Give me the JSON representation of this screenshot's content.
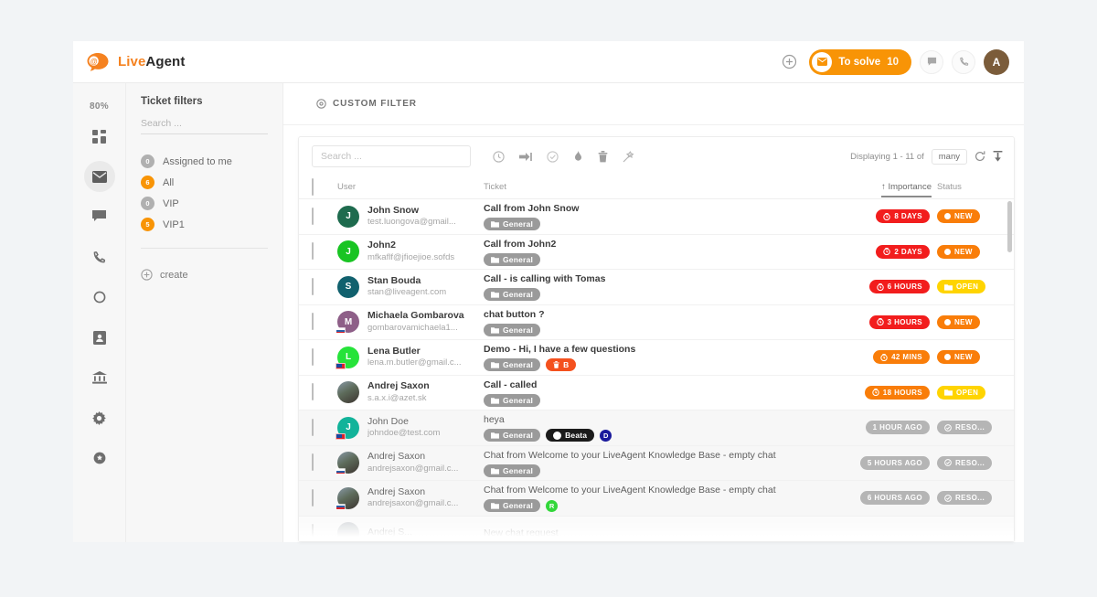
{
  "topbar": {
    "logo_live": "Live",
    "logo_agent": "Agent",
    "add_icon": "plus-circle-icon",
    "tosolve_label": "To solve",
    "tosolve_count": "10",
    "chat_icon": "chat-icon",
    "phone_icon": "phone-icon",
    "avatar_initial": "A"
  },
  "rail": {
    "percent": "80%",
    "items": [
      {
        "icon": "dashboard-grid-icon",
        "active": false
      },
      {
        "icon": "envelope-icon",
        "active": true
      },
      {
        "icon": "chat-bubble-icon",
        "active": false
      },
      {
        "icon": "phone-icon",
        "active": false
      },
      {
        "icon": "circle-outline-icon",
        "active": false
      },
      {
        "icon": "contacts-card-icon",
        "active": false
      },
      {
        "icon": "bank-building-icon",
        "active": false
      },
      {
        "icon": "gear-icon",
        "active": false
      },
      {
        "icon": "settings-filled-icon",
        "active": false
      }
    ]
  },
  "filters": {
    "title": "Ticket filters",
    "search_placeholder": "Search ...",
    "items": [
      {
        "count": "0",
        "label": "Assigned to me",
        "color": "gray"
      },
      {
        "count": "6",
        "label": "All",
        "color": "orange"
      },
      {
        "count": "0",
        "label": "VIP",
        "color": "gray"
      },
      {
        "count": "5",
        "label": "VIP1",
        "color": "orange"
      }
    ],
    "create_label": "create"
  },
  "main": {
    "custom_filter_label": "CUSTOM FILTER",
    "search_placeholder": "Search ...",
    "actions": [
      {
        "icon": "clock-history-icon"
      },
      {
        "icon": "transfer-arrow-icon"
      },
      {
        "icon": "resolve-check-icon"
      },
      {
        "icon": "flame-icon"
      },
      {
        "icon": "trash-icon"
      },
      {
        "icon": "magic-wand-icon"
      }
    ],
    "displaying_text": "Displaying 1 - 11 of",
    "many_label": "many",
    "refresh_icon": "refresh-icon",
    "export_icon": "export-icon",
    "columns": {
      "user": "User",
      "ticket": "Ticket",
      "importance": "↑ Importance",
      "status": "Status"
    }
  },
  "tickets": [
    {
      "name": "John Snow",
      "email": "test.luongova@gmail...",
      "subject": "Call from John Snow",
      "read": false,
      "avatar": {
        "initial": "J",
        "color": "#1e6b4e",
        "photo": false,
        "flag": ""
      },
      "tags": [
        {
          "type": "dept",
          "label": "General"
        }
      ],
      "importance": "8 DAYS",
      "importance_color": "red",
      "importance_icon": "clock-icon",
      "status": "NEW",
      "status_color": "orange",
      "status_icon": "dot-icon"
    },
    {
      "name": "John2",
      "email": "mfkaflf@jfioejioe.sofds",
      "subject": "Call from John2",
      "read": false,
      "avatar": {
        "initial": "J",
        "color": "#19c423",
        "photo": false,
        "flag": ""
      },
      "tags": [
        {
          "type": "dept",
          "label": "General"
        }
      ],
      "importance": "2 DAYS",
      "importance_color": "red",
      "importance_icon": "clock-icon",
      "status": "NEW",
      "status_color": "orange",
      "status_icon": "dot-icon"
    },
    {
      "name": "Stan Bouda",
      "email": "stan@liveagent.com",
      "subject": "Call - is calling with Tomas",
      "read": false,
      "avatar": {
        "initial": "S",
        "color": "#11616e",
        "photo": false,
        "flag": ""
      },
      "tags": [
        {
          "type": "dept",
          "label": "General"
        }
      ],
      "importance": "6 HOURS",
      "importance_color": "red",
      "importance_icon": "clock-icon",
      "status": "OPEN",
      "status_color": "yellow",
      "status_icon": "folder-icon"
    },
    {
      "name": "Michaela Gombarova",
      "email": "gombarovamichaela1...",
      "subject": "chat button ?",
      "read": false,
      "avatar": {
        "initial": "M",
        "color": "#8e5f88",
        "photo": false,
        "flag": "sk"
      },
      "tags": [
        {
          "type": "dept",
          "label": "General"
        }
      ],
      "importance": "3 HOURS",
      "importance_color": "red",
      "importance_icon": "clock-icon",
      "status": "NEW",
      "status_color": "orange",
      "status_icon": "dot-icon"
    },
    {
      "name": "Lena Butler",
      "email": "lena.m.butler@gmail.c...",
      "subject": "Demo - Hi, I have a few questions",
      "read": false,
      "avatar": {
        "initial": "L",
        "color": "#26e33a",
        "photo": false,
        "flag": "tw"
      },
      "tags": [
        {
          "type": "dept",
          "label": "General"
        },
        {
          "type": "orange",
          "label": "B"
        }
      ],
      "importance": "42 MINS",
      "importance_color": "orange",
      "importance_icon": "clock-icon",
      "status": "NEW",
      "status_color": "orange",
      "status_icon": "dot-icon"
    },
    {
      "name": "Andrej Saxon",
      "email": "s.a.x.i@azet.sk",
      "subject": "Call - called",
      "read": false,
      "avatar": {
        "initial": "",
        "color": "#6c7a89",
        "photo": true,
        "flag": ""
      },
      "tags": [
        {
          "type": "dept",
          "label": "General"
        }
      ],
      "importance": "18 HOURS",
      "importance_color": "orange",
      "importance_icon": "clock-icon",
      "status": "OPEN",
      "status_color": "yellow",
      "status_icon": "folder-icon"
    },
    {
      "name": "John Doe",
      "email": "johndoe@test.com",
      "subject": "heya",
      "read": true,
      "avatar": {
        "initial": "J",
        "color": "#12b39a",
        "photo": false,
        "flag": "tw"
      },
      "tags": [
        {
          "type": "dept",
          "label": "General"
        },
        {
          "type": "black",
          "label": "Beata"
        },
        {
          "type": "dot",
          "label": "D",
          "color": "#1a1a9c"
        }
      ],
      "importance": "1 HOUR AGO",
      "importance_color": "gray",
      "importance_icon": "",
      "status": "RESO...",
      "status_color": "gray",
      "status_icon": "resolve-check-icon"
    },
    {
      "name": "Andrej Saxon",
      "email": "andrejsaxon@gmail.c...",
      "subject": "Chat from Welcome to your LiveAgent Knowledge Base - empty chat",
      "read": true,
      "avatar": {
        "initial": "",
        "color": "#6c7a89",
        "photo": true,
        "flag": "sk"
      },
      "tags": [
        {
          "type": "dept",
          "label": "General"
        }
      ],
      "importance": "5 HOURS AGO",
      "importance_color": "gray",
      "importance_icon": "",
      "status": "RESO...",
      "status_color": "gray",
      "status_icon": "resolve-check-icon"
    },
    {
      "name": "Andrej Saxon",
      "email": "andrejsaxon@gmail.c...",
      "subject": "Chat from Welcome to your LiveAgent Knowledge Base - empty chat",
      "read": true,
      "avatar": {
        "initial": "",
        "color": "#6c7a89",
        "photo": true,
        "flag": "sk"
      },
      "tags": [
        {
          "type": "dept",
          "label": "General"
        },
        {
          "type": "dot",
          "label": "R",
          "color": "#32d73a"
        }
      ],
      "importance": "6 HOURS AGO",
      "importance_color": "gray",
      "importance_icon": "",
      "status": "RESO...",
      "status_color": "gray",
      "status_icon": "resolve-check-icon"
    }
  ],
  "colors": {
    "brand_orange": "#f58220",
    "accent_orange": "#f89406",
    "red": "#f21d1d",
    "yellow": "#ffd400",
    "gray": "#b5b5b5"
  }
}
